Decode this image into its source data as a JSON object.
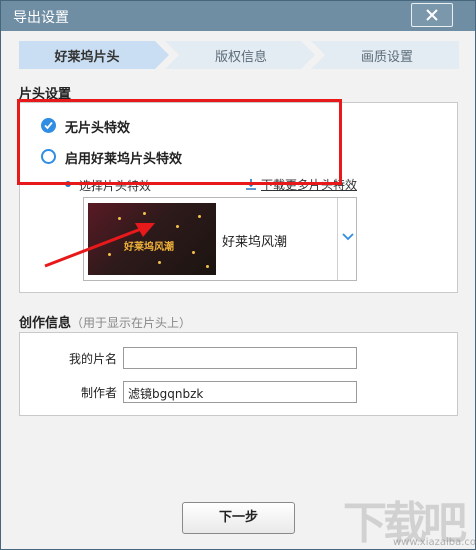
{
  "window": {
    "title": "导出设置"
  },
  "steps": [
    {
      "label": "好莱坞片头",
      "active": true
    },
    {
      "label": "版权信息",
      "active": false
    },
    {
      "label": "画质设置",
      "active": false
    }
  ],
  "intro_section": {
    "label": "片头设置",
    "option_none": "无片头特效",
    "option_enable": "启用好莱坞片头特效",
    "selected_option": "无片头特效",
    "choose_label": "选择片头特效",
    "download_link": "下载更多片头特效",
    "effect_thumb_text": "好莱坞风潮",
    "effect_name": "好莱坞风潮"
  },
  "creation_section": {
    "label": "创作信息",
    "hint": "（用于显示在片头上）",
    "title_label": "我的片名",
    "title_value": "",
    "author_label": "制作者",
    "author_value": "滤镜bgqnbzk"
  },
  "footer": {
    "next_button": "下一步"
  },
  "watermark": {
    "big": "下载吧",
    "small": "www.xiazaiba.com"
  },
  "colors": {
    "accent": "#2f8de4",
    "annotation": "#e8191b",
    "titlebar": "#6f8da3"
  }
}
